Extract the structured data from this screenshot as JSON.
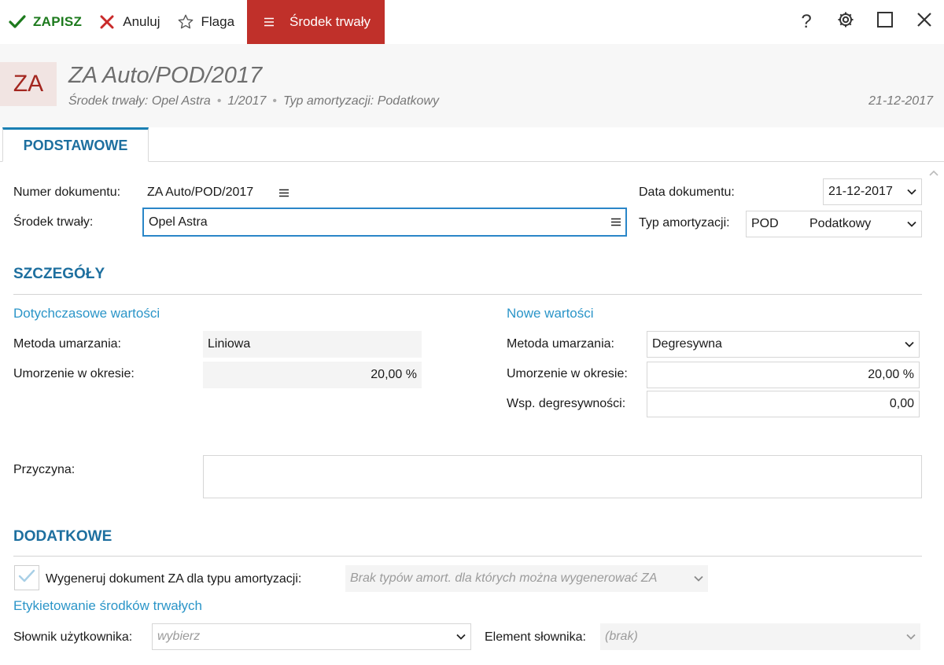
{
  "toolbar": {
    "save": "ZAPISZ",
    "cancel": "Anuluj",
    "flag": "Flaga",
    "menu": "Środek trwały",
    "help": "?"
  },
  "header": {
    "badge": "ZA",
    "title": "ZA Auto/POD/2017",
    "sub_asset": "Środek trwały: Opel Astra",
    "sub_number": "1/2017",
    "sub_type": "Typ amortyzacji: Podatkowy",
    "date": "21-12-2017"
  },
  "tabs": [
    {
      "label": "PODSTAWOWE"
    }
  ],
  "form": {
    "doc_number_label": "Numer dokumentu:",
    "doc_number_value": "ZA Auto/POD/2017",
    "asset_label": "Środek trwały:",
    "asset_value": "Opel Astra",
    "doc_date_label": "Data dokumentu:",
    "doc_date_value": "21-12-2017",
    "amort_type_label": "Typ amortyzacji:",
    "amort_type_code": "POD",
    "amort_type_name": "Podatkowy"
  },
  "details": {
    "section_title": "SZCZEGÓŁY",
    "previous_title": "Dotychczasowe wartości",
    "new_title": "Nowe wartości",
    "method_label": "Metoda umarzania:",
    "prev_method": "Liniowa",
    "new_method": "Degresywna",
    "rate_label": "Umorzenie w okresie:",
    "prev_rate": "20,00 %",
    "new_rate": "20,00 %",
    "degressive_label": "Wsp. degresywności:",
    "degressive_value": "0,00",
    "reason_label": "Przyczyna:",
    "reason_value": ""
  },
  "additional": {
    "section_title": "DODATKOWE",
    "generate_label": "Wygeneruj dokument ZA dla typu amortyzacji:",
    "generate_placeholder": "Brak typów amort. dla których można wygenerować ZA",
    "labeling_title": "Etykietowanie środków trwałych",
    "dictionary_label": "Słownik użytkownika:",
    "dictionary_placeholder": "wybierz",
    "element_label": "Element słownika:",
    "element_value": "(brak)"
  },
  "colors": {
    "accent_red": "#c0302a",
    "accent_blue": "#1d6f9f",
    "link_blue": "#2b95c8",
    "save_green": "#1d7a1d"
  }
}
